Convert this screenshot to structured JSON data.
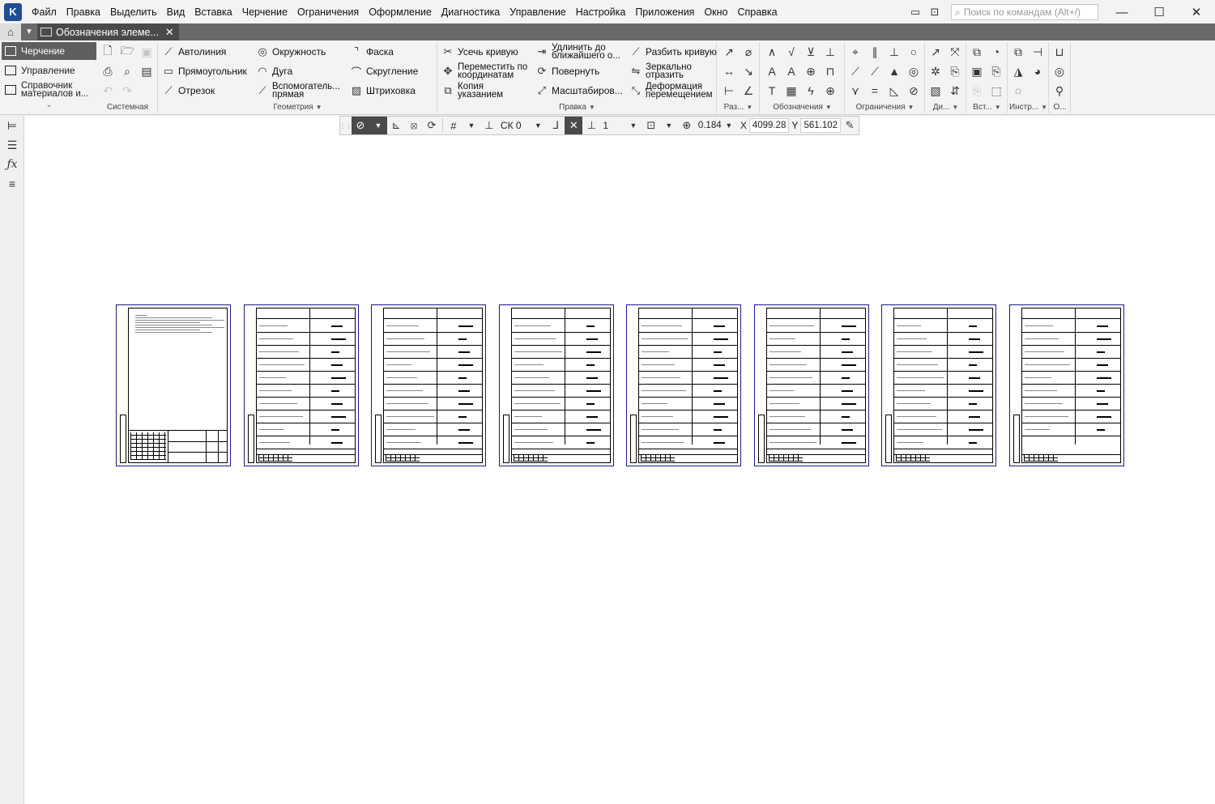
{
  "menu": [
    "Файл",
    "Правка",
    "Выделить",
    "Вид",
    "Вставка",
    "Черчение",
    "Ограничения",
    "Оформление",
    "Диагностика",
    "Управление",
    "Настройка",
    "Приложения",
    "Окно",
    "Справка"
  ],
  "search": {
    "placeholder": "Поиск по командам (Alt+/)"
  },
  "tab": {
    "title": "Обозначения элеме..."
  },
  "modes": {
    "drawing": "Черчение",
    "management": "Управление",
    "reference_1": "Справочник",
    "reference_2": "материалов и..."
  },
  "groups": {
    "system": "Системная",
    "geometry": "Геометрия",
    "edit": "Правка",
    "dimensions": "Раз...",
    "designations": "Обозначения",
    "constraints": "Ограничения",
    "di": "Ди...",
    "insert": "Вст...",
    "tools": "Инстр...",
    "o": "О..."
  },
  "geometry_cmds": {
    "autoline": "Автолиния",
    "rectangle": "Прямоугольник",
    "segment": "Отрезок",
    "circle": "Окружность",
    "arc": "Дуга",
    "aux_1": "Вспомогатель...",
    "aux_2": "прямая",
    "chamfer": "Фаска",
    "fillet": "Скругление",
    "hatch": "Штриховка"
  },
  "edit_cmds": {
    "trim": "Усечь кривую",
    "move_1": "Переместить по",
    "move_2": "координатам",
    "copy_1": "Копия",
    "copy_2": "указанием",
    "extend_1": "Удлинить до",
    "extend_2": "ближайшего о...",
    "rotate": "Повернуть",
    "scale": "Масштабиров...",
    "split": "Разбить кривую",
    "mirror_1": "Зеркально",
    "mirror_2": "отразить",
    "deform_1": "Деформация",
    "deform_2": "перемещением"
  },
  "floating_toolbar": {
    "cs": "СК 0",
    "layer": "1",
    "zoom": "0.184",
    "x_label": "X",
    "x_value": "4099.28",
    "y_label": "Y",
    "y_value": "561.102"
  },
  "sheets_count": 8
}
